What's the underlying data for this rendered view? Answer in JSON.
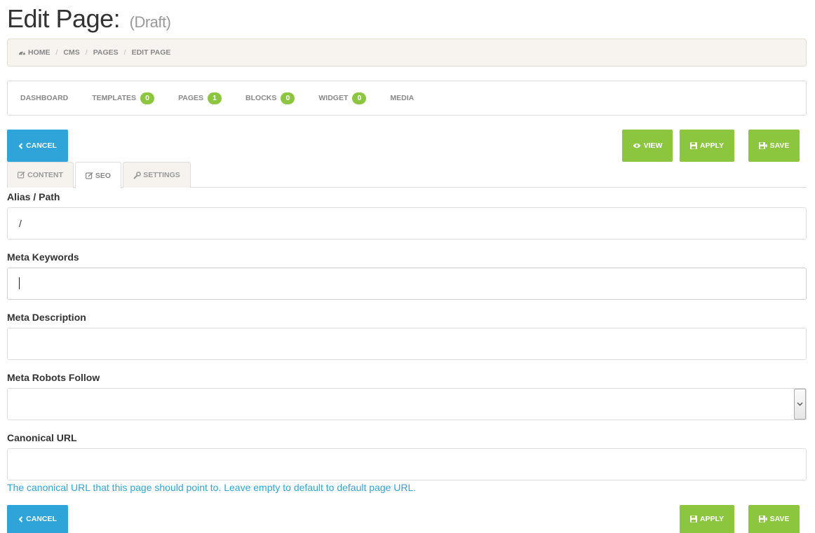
{
  "header": {
    "title": "Edit Page:",
    "status": "(Draft)"
  },
  "breadcrumb": {
    "icon": "dashboard-icon",
    "items": [
      "HOME",
      "CMS",
      "PAGES",
      "EDIT PAGE"
    ]
  },
  "subnav": {
    "items": [
      {
        "label": "DASHBOARD"
      },
      {
        "label": "TEMPLATES",
        "badge": "0"
      },
      {
        "label": "PAGES",
        "badge": "1"
      },
      {
        "label": "BLOCKS",
        "badge": "0"
      },
      {
        "label": "WIDGET",
        "badge": "0"
      },
      {
        "label": "MEDIA"
      }
    ]
  },
  "toolbar": {
    "cancel_label": "CANCEL",
    "view_label": "VIEW",
    "apply_label": "APPLY",
    "save_label": "SAVE"
  },
  "tabs": [
    {
      "label": "CONTENT",
      "icon": "edit-icon"
    },
    {
      "label": "SEO",
      "icon": "edit-icon",
      "active": true
    },
    {
      "label": "SETTINGS",
      "icon": "wrench-icon"
    }
  ],
  "form": {
    "alias": {
      "label": "Alias / Path",
      "value": "/"
    },
    "meta_keywords": {
      "label": "Meta Keywords",
      "value": ""
    },
    "meta_description": {
      "label": "Meta Description",
      "value": ""
    },
    "meta_robots": {
      "label": "Meta Robots Follow",
      "value": ""
    },
    "canonical": {
      "label": "Canonical URL",
      "value": "",
      "help": "The canonical URL that this page should point to. Leave empty to default to default page URL."
    }
  },
  "colors": {
    "primary": "#2fa4d9",
    "success": "#8cc63f",
    "breadcrumb_bg": "#f7f4ef"
  }
}
